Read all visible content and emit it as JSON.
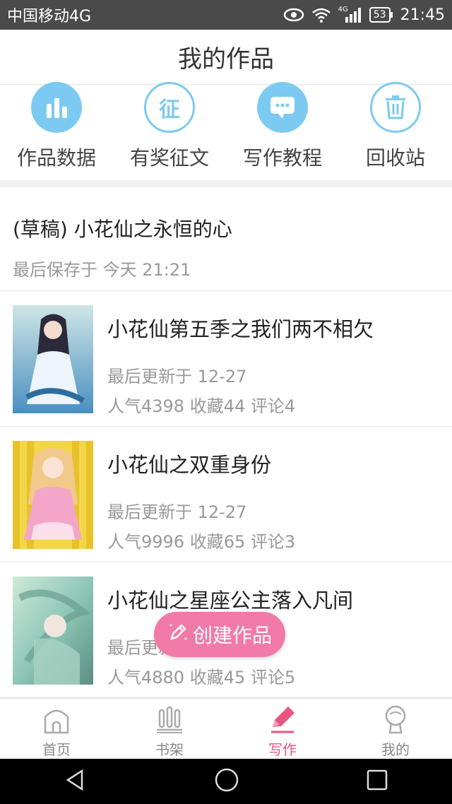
{
  "status_bar": {
    "carrier": "中国移动4G",
    "network": "4G",
    "battery": "53",
    "time": "21:45"
  },
  "header": {
    "title": "我的作品"
  },
  "shortcuts": [
    {
      "label": "作品数据",
      "icon": "bar-chart-icon"
    },
    {
      "label": "有奖征文",
      "icon": "contest-icon",
      "glyph": "征"
    },
    {
      "label": "写作教程",
      "icon": "chat-bubble-icon"
    },
    {
      "label": "回收站",
      "icon": "trash-icon"
    }
  ],
  "draft": {
    "title": "(草稿) 小花仙之永恒的心",
    "saved": "最后保存于 今天 21:21"
  },
  "works": [
    {
      "title": "小花仙第五季之我们两不相欠",
      "updated": "最后更新于 12-27",
      "stats": "人气4398 收藏44 评论4"
    },
    {
      "title": "小花仙之双重身份",
      "updated": "最后更新于 12-27",
      "stats": "人气9996 收藏65 评论3"
    },
    {
      "title": "小花仙之星座公主落入凡间",
      "updated": "最后更新于 12-27",
      "stats": "人气4880 收藏45 评论5"
    }
  ],
  "fab": {
    "label": "创建作品"
  },
  "tabbar": [
    {
      "label": "首页",
      "icon": "home-icon"
    },
    {
      "label": "书架",
      "icon": "bookshelf-icon"
    },
    {
      "label": "写作",
      "icon": "pencil-icon",
      "active": true
    },
    {
      "label": "我的",
      "icon": "profile-icon"
    }
  ],
  "colors": {
    "accent_blue": "#7ccaf2",
    "accent_pink": "#f27aa8",
    "active_tab": "#e8557f"
  }
}
